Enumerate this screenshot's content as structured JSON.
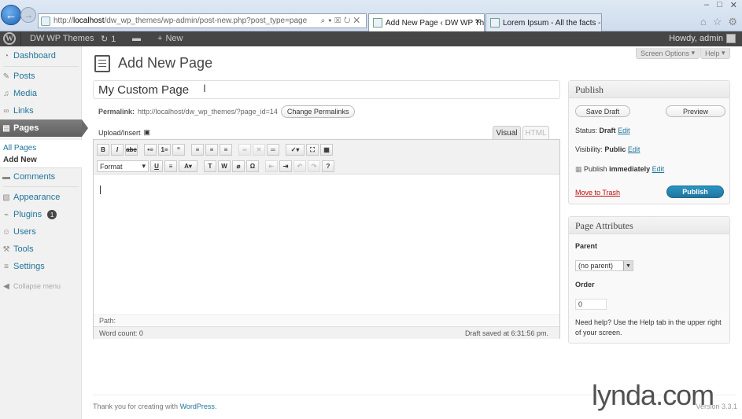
{
  "browser": {
    "url_prefix": "http://",
    "url_host": "localhost",
    "url_path": "/dw_wp_themes/wp-admin/post-new.php?post_type=page",
    "tabs": [
      {
        "label": "Add New Page ‹ DW WP Th..."
      },
      {
        "label": "Lorem Ipsum - All the facts - Li..."
      }
    ]
  },
  "adminbar": {
    "site_name": "DW WP Themes",
    "updates_count": "1",
    "new_label": "New",
    "howdy": "Howdy, admin"
  },
  "sidebar": {
    "items": [
      {
        "label": "Dashboard",
        "icon": "dashboard-icon"
      },
      {
        "label": "Posts",
        "icon": "posts-icon"
      },
      {
        "label": "Media",
        "icon": "media-icon"
      },
      {
        "label": "Links",
        "icon": "links-icon"
      },
      {
        "label": "Pages",
        "icon": "pages-icon"
      },
      {
        "label": "Comments",
        "icon": "comments-icon"
      },
      {
        "label": "Appearance",
        "icon": "appearance-icon"
      },
      {
        "label": "Plugins",
        "icon": "plugins-icon"
      },
      {
        "label": "Users",
        "icon": "users-icon"
      },
      {
        "label": "Tools",
        "icon": "tools-icon"
      },
      {
        "label": "Settings",
        "icon": "settings-icon"
      },
      {
        "label": "Collapse menu",
        "icon": "collapse-icon"
      }
    ],
    "pages_sub": [
      "All Pages",
      "Add New"
    ],
    "plugins_badge": "1"
  },
  "header": {
    "screen_options": "Screen Options",
    "help": "Help",
    "title": "Add New Page"
  },
  "editor": {
    "title_value": "My Custom Page",
    "permalink_label": "Permalink:",
    "permalink_url": "http://localhost/dw_wp_themes/?page_id=14",
    "change_permalinks": "Change Permalinks",
    "upload_insert": "Upload/Insert",
    "tab_visual": "Visual",
    "tab_html": "HTML",
    "format_label": "Format",
    "path_label": "Path:",
    "word_count": "Word count: 0",
    "draft_saved": "Draft saved at 6:31:56 pm."
  },
  "publish": {
    "title": "Publish",
    "save_draft": "Save Draft",
    "preview": "Preview",
    "status_label": "Status:",
    "status_value": "Draft",
    "visibility_label": "Visibility:",
    "visibility_value": "Public",
    "publish_label": "Publish",
    "publish_when": "immediately",
    "edit": "Edit",
    "move_to_trash": "Move to Trash",
    "publish_button": "Publish"
  },
  "attributes": {
    "title": "Page Attributes",
    "parent_label": "Parent",
    "parent_value": "(no parent)",
    "order_label": "Order",
    "order_value": "0",
    "help_text": "Need help? Use the Help tab in the upper right of your screen."
  },
  "footer": {
    "thanks_prefix": "Thank you for creating with",
    "wordpress_link": "WordPress",
    "version": "Version 3.3.1"
  },
  "watermark": "lynda.com"
}
